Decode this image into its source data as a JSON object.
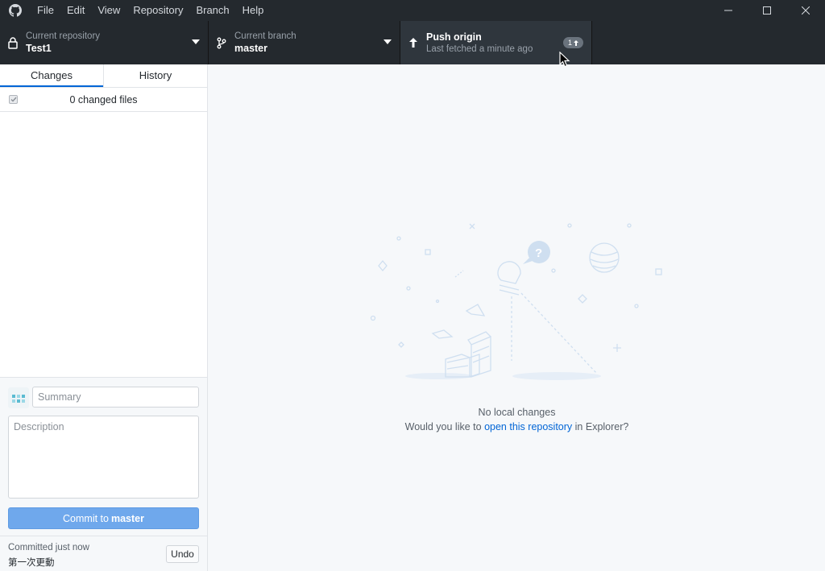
{
  "titlebar": {
    "menus": [
      "File",
      "Edit",
      "View",
      "Repository",
      "Branch",
      "Help"
    ]
  },
  "toolbar": {
    "repo": {
      "label": "Current repository",
      "value": "Test1"
    },
    "branch": {
      "label": "Current branch",
      "value": "master"
    },
    "push": {
      "label": "Push origin",
      "status": "Last fetched a minute ago",
      "badge_count": "1"
    }
  },
  "sidebar": {
    "tabs": [
      "Changes",
      "History"
    ],
    "changed_files": "0 changed files",
    "summary_placeholder": "Summary",
    "description_placeholder": "Description",
    "commit_prefix": "Commit to",
    "commit_branch": "master",
    "last_commit": {
      "status": "Committed just now",
      "message": "第一次更動",
      "undo_label": "Undo"
    }
  },
  "main": {
    "empty_title": "No local changes",
    "empty_prefix": "Would you like to",
    "empty_link": "open this repository",
    "empty_suffix": "in Explorer?"
  },
  "colors": {
    "chrome": "#24292e",
    "accent": "#0366d6",
    "commit_button": "#6fa8ec"
  }
}
